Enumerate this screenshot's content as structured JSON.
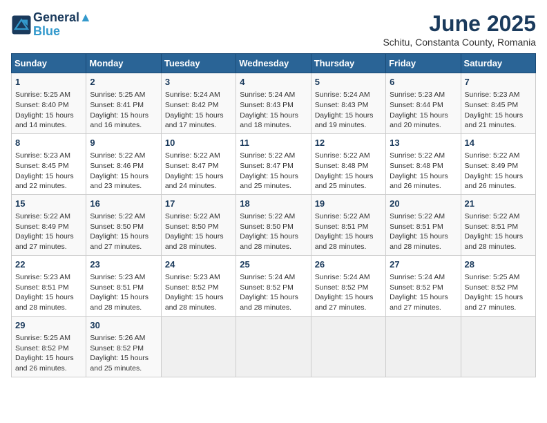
{
  "header": {
    "logo_line1": "General",
    "logo_line2": "Blue",
    "month": "June 2025",
    "location": "Schitu, Constanta County, Romania"
  },
  "weekdays": [
    "Sunday",
    "Monday",
    "Tuesday",
    "Wednesday",
    "Thursday",
    "Friday",
    "Saturday"
  ],
  "weeks": [
    [
      {
        "day": "1",
        "info": "Sunrise: 5:25 AM\nSunset: 8:40 PM\nDaylight: 15 hours\nand 14 minutes."
      },
      {
        "day": "2",
        "info": "Sunrise: 5:25 AM\nSunset: 8:41 PM\nDaylight: 15 hours\nand 16 minutes."
      },
      {
        "day": "3",
        "info": "Sunrise: 5:24 AM\nSunset: 8:42 PM\nDaylight: 15 hours\nand 17 minutes."
      },
      {
        "day": "4",
        "info": "Sunrise: 5:24 AM\nSunset: 8:43 PM\nDaylight: 15 hours\nand 18 minutes."
      },
      {
        "day": "5",
        "info": "Sunrise: 5:24 AM\nSunset: 8:43 PM\nDaylight: 15 hours\nand 19 minutes."
      },
      {
        "day": "6",
        "info": "Sunrise: 5:23 AM\nSunset: 8:44 PM\nDaylight: 15 hours\nand 20 minutes."
      },
      {
        "day": "7",
        "info": "Sunrise: 5:23 AM\nSunset: 8:45 PM\nDaylight: 15 hours\nand 21 minutes."
      }
    ],
    [
      {
        "day": "8",
        "info": "Sunrise: 5:23 AM\nSunset: 8:45 PM\nDaylight: 15 hours\nand 22 minutes."
      },
      {
        "day": "9",
        "info": "Sunrise: 5:22 AM\nSunset: 8:46 PM\nDaylight: 15 hours\nand 23 minutes."
      },
      {
        "day": "10",
        "info": "Sunrise: 5:22 AM\nSunset: 8:47 PM\nDaylight: 15 hours\nand 24 minutes."
      },
      {
        "day": "11",
        "info": "Sunrise: 5:22 AM\nSunset: 8:47 PM\nDaylight: 15 hours\nand 25 minutes."
      },
      {
        "day": "12",
        "info": "Sunrise: 5:22 AM\nSunset: 8:48 PM\nDaylight: 15 hours\nand 25 minutes."
      },
      {
        "day": "13",
        "info": "Sunrise: 5:22 AM\nSunset: 8:48 PM\nDaylight: 15 hours\nand 26 minutes."
      },
      {
        "day": "14",
        "info": "Sunrise: 5:22 AM\nSunset: 8:49 PM\nDaylight: 15 hours\nand 26 minutes."
      }
    ],
    [
      {
        "day": "15",
        "info": "Sunrise: 5:22 AM\nSunset: 8:49 PM\nDaylight: 15 hours\nand 27 minutes."
      },
      {
        "day": "16",
        "info": "Sunrise: 5:22 AM\nSunset: 8:50 PM\nDaylight: 15 hours\nand 27 minutes."
      },
      {
        "day": "17",
        "info": "Sunrise: 5:22 AM\nSunset: 8:50 PM\nDaylight: 15 hours\nand 28 minutes."
      },
      {
        "day": "18",
        "info": "Sunrise: 5:22 AM\nSunset: 8:50 PM\nDaylight: 15 hours\nand 28 minutes."
      },
      {
        "day": "19",
        "info": "Sunrise: 5:22 AM\nSunset: 8:51 PM\nDaylight: 15 hours\nand 28 minutes."
      },
      {
        "day": "20",
        "info": "Sunrise: 5:22 AM\nSunset: 8:51 PM\nDaylight: 15 hours\nand 28 minutes."
      },
      {
        "day": "21",
        "info": "Sunrise: 5:22 AM\nSunset: 8:51 PM\nDaylight: 15 hours\nand 28 minutes."
      }
    ],
    [
      {
        "day": "22",
        "info": "Sunrise: 5:23 AM\nSunset: 8:51 PM\nDaylight: 15 hours\nand 28 minutes."
      },
      {
        "day": "23",
        "info": "Sunrise: 5:23 AM\nSunset: 8:51 PM\nDaylight: 15 hours\nand 28 minutes."
      },
      {
        "day": "24",
        "info": "Sunrise: 5:23 AM\nSunset: 8:52 PM\nDaylight: 15 hours\nand 28 minutes."
      },
      {
        "day": "25",
        "info": "Sunrise: 5:24 AM\nSunset: 8:52 PM\nDaylight: 15 hours\nand 28 minutes."
      },
      {
        "day": "26",
        "info": "Sunrise: 5:24 AM\nSunset: 8:52 PM\nDaylight: 15 hours\nand 27 minutes."
      },
      {
        "day": "27",
        "info": "Sunrise: 5:24 AM\nSunset: 8:52 PM\nDaylight: 15 hours\nand 27 minutes."
      },
      {
        "day": "28",
        "info": "Sunrise: 5:25 AM\nSunset: 8:52 PM\nDaylight: 15 hours\nand 27 minutes."
      }
    ],
    [
      {
        "day": "29",
        "info": "Sunrise: 5:25 AM\nSunset: 8:52 PM\nDaylight: 15 hours\nand 26 minutes."
      },
      {
        "day": "30",
        "info": "Sunrise: 5:26 AM\nSunset: 8:52 PM\nDaylight: 15 hours\nand 25 minutes."
      },
      {
        "day": "",
        "info": ""
      },
      {
        "day": "",
        "info": ""
      },
      {
        "day": "",
        "info": ""
      },
      {
        "day": "",
        "info": ""
      },
      {
        "day": "",
        "info": ""
      }
    ]
  ]
}
